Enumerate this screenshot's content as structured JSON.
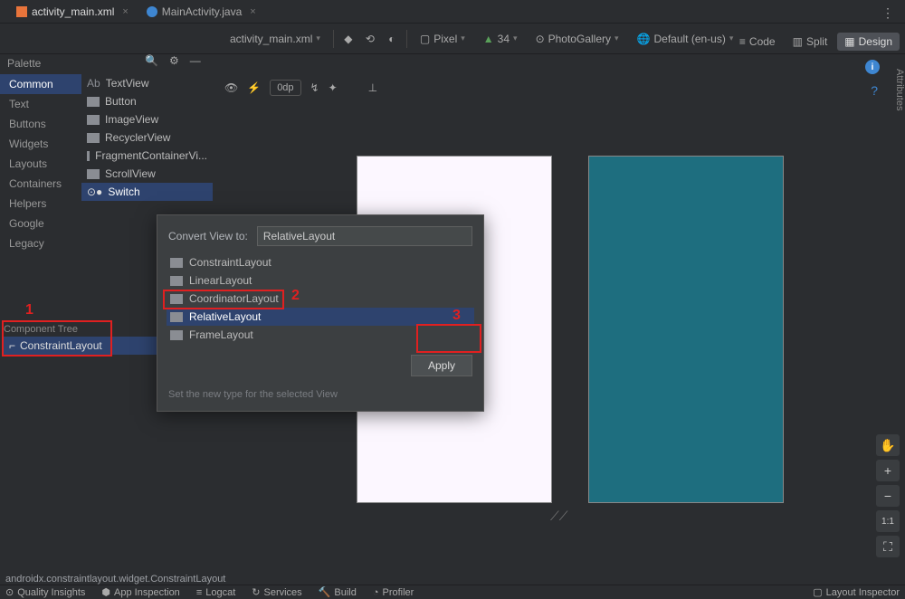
{
  "tabs": [
    {
      "label": "activity_main.xml",
      "type": "xml",
      "active": true
    },
    {
      "label": "MainActivity.java",
      "type": "java",
      "active": false
    }
  ],
  "view_modes": {
    "code": "Code",
    "split": "Split",
    "design": "Design"
  },
  "toolbar": {
    "file_dropdown": "activity_main.xml",
    "device": "Pixel",
    "api": "34",
    "app_theme": "PhotoGallery",
    "locale": "Default (en-us)"
  },
  "subtoolbar": {
    "zero_dp": "0dp"
  },
  "palette": {
    "title": "Palette",
    "categories": [
      "Common",
      "Text",
      "Buttons",
      "Widgets",
      "Layouts",
      "Containers",
      "Helpers",
      "Google",
      "Legacy"
    ],
    "selected_category": "Common",
    "widgets": [
      "TextView",
      "Button",
      "ImageView",
      "RecyclerView",
      "FragmentContainerVi...",
      "ScrollView",
      "Switch"
    ],
    "selected_widget": "Switch"
  },
  "component_tree": {
    "title": "Component Tree",
    "root": "ConstraintLayout"
  },
  "dialog": {
    "label": "Convert View to:",
    "input": "RelativeLayout",
    "options": [
      "ConstraintLayout",
      "LinearLayout",
      "CoordinatorLayout",
      "RelativeLayout",
      "FrameLayout"
    ],
    "selected": "RelativeLayout",
    "button": "Apply",
    "hint": "Set the new type for the selected View"
  },
  "annotations": {
    "a1": "1",
    "a2": "2",
    "a3": "3"
  },
  "status": "androidx.constraintlayout.widget.ConstraintLayout",
  "side_panel": "Attributes",
  "bottom_bar": {
    "items": [
      "Quality Insights",
      "App Inspection",
      "Logcat",
      "Services",
      "Build",
      "Profiler"
    ],
    "right": "Layout Inspector"
  },
  "side_tools": {
    "zoom_fit": "1:1"
  }
}
